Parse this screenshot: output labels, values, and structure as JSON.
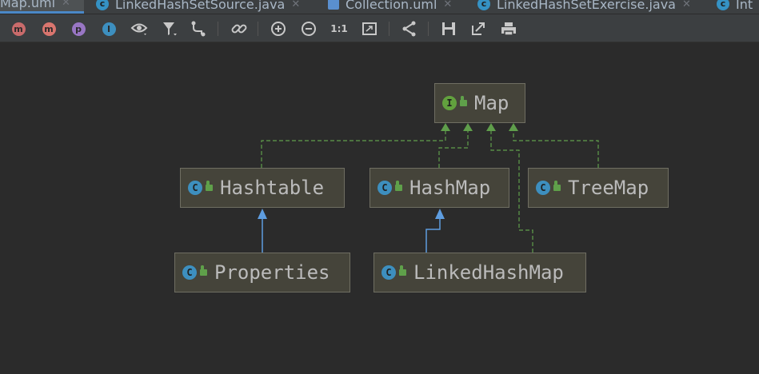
{
  "tabs": [
    {
      "label": "Map.uml",
      "icon": "uml-icon",
      "active": true
    },
    {
      "label": "LinkedHashSetSource.java",
      "icon": "class-icon",
      "active": false
    },
    {
      "label": "Collection.uml",
      "icon": "uml-icon",
      "active": false
    },
    {
      "label": "LinkedHashSetExercise.java",
      "icon": "class-icon",
      "active": false
    },
    {
      "label": "Int",
      "icon": "class-icon",
      "active": false
    }
  ],
  "toolbar": {
    "buttons": [
      {
        "name": "show-fields-button",
        "glyph": "m"
      },
      {
        "name": "show-methods-button",
        "glyph": "m"
      },
      {
        "name": "show-properties-button",
        "glyph": "p"
      },
      {
        "name": "show-inner-classes-button",
        "glyph": "I"
      },
      {
        "name": "visibility-button",
        "glyph": "👁"
      },
      {
        "name": "filter-button",
        "glyph": "▼"
      },
      {
        "name": "show-dependencies-button",
        "glyph": "↳"
      },
      {
        "name": "link-button",
        "glyph": "🔗"
      },
      {
        "name": "zoom-in-button",
        "glyph": "+"
      },
      {
        "name": "zoom-out-button",
        "glyph": "−"
      },
      {
        "name": "actual-size-button",
        "glyph": "1:1"
      },
      {
        "name": "fit-content-button",
        "glyph": "⤢"
      },
      {
        "name": "layout-button",
        "glyph": "<"
      },
      {
        "name": "save-button",
        "glyph": "💾"
      },
      {
        "name": "export-button",
        "glyph": "↗"
      },
      {
        "name": "print-button",
        "glyph": "🖨"
      }
    ]
  },
  "diagram": {
    "nodes": {
      "map": {
        "label": "Map",
        "kind": "I",
        "kind_color": "#62a13e"
      },
      "hashtable": {
        "label": "Hashtable",
        "kind": "C",
        "kind_color": "#3d8fbf"
      },
      "hashmap": {
        "label": "HashMap",
        "kind": "C",
        "kind_color": "#3d8fbf"
      },
      "treemap": {
        "label": "TreeMap",
        "kind": "C",
        "kind_color": "#3d8fbf"
      },
      "properties": {
        "label": "Properties",
        "kind": "C",
        "kind_color": "#3d8fbf"
      },
      "linkedhashmap": {
        "label": "LinkedHashMap",
        "kind": "C",
        "kind_color": "#3d8fbf"
      }
    },
    "colors": {
      "implements": "#5f9e4b",
      "extends": "#5e9de0"
    }
  }
}
